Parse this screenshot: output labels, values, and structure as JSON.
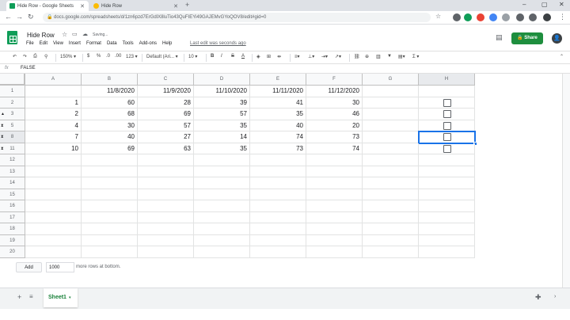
{
  "browser": {
    "tabs": [
      {
        "title": "Hide Row - Google Sheets",
        "active": true
      },
      {
        "title": "Hide Row",
        "active": false
      }
    ],
    "url": "docs.google.com/spreadsheets/d/1zn6pzd7ErGdlX8luTio43QuFIEYi49GAJEMvGYoQOV8/edit#gid=0"
  },
  "header": {
    "title": "Hide Row",
    "saving": "Saving...",
    "menu": [
      "File",
      "Edit",
      "View",
      "Insert",
      "Format",
      "Data",
      "Tools",
      "Add-ons",
      "Help"
    ],
    "last_edit": "Last edit was seconds ago",
    "share_label": "Share",
    "avatar": "👤"
  },
  "toolbar": {
    "zoom": "150%",
    "currency": "$",
    "percent": "%",
    "decimal_dec": ".0",
    "decimal_inc": ".00",
    "number_format": "123",
    "font": "Default (Ari...",
    "font_size": "10",
    "bold": "B",
    "italic": "I",
    "strike": "S",
    "text_color": "A"
  },
  "formula": {
    "label": "fx",
    "value": "FALSE"
  },
  "grid": {
    "columns": [
      "A",
      "B",
      "C",
      "D",
      "E",
      "F",
      "G",
      "H"
    ],
    "selected_column": "H",
    "rows": [
      {
        "num": "1",
        "cells": [
          "",
          "11/8/2020",
          "11/9/2020",
          "11/10/2020",
          "11/11/2020",
          "11/12/2020",
          "",
          ""
        ],
        "hidden_marker": false
      },
      {
        "num": "2",
        "cells": [
          "1",
          "60",
          "28",
          "39",
          "41",
          "30",
          "",
          "checkbox"
        ],
        "hidden_marker": false
      },
      {
        "num": "3",
        "cells": [
          "2",
          "68",
          "69",
          "57",
          "35",
          "46",
          "",
          "checkbox"
        ],
        "hidden_marker": true
      },
      {
        "num": "5",
        "cells": [
          "4",
          "30",
          "57",
          "35",
          "40",
          "20",
          "",
          "checkbox"
        ],
        "hidden_marker": true
      },
      {
        "num": "8",
        "cells": [
          "7",
          "40",
          "27",
          "14",
          "74",
          "73",
          "",
          "checkbox"
        ],
        "hidden_marker": true,
        "selected": true
      },
      {
        "num": "11",
        "cells": [
          "10",
          "69",
          "63",
          "35",
          "73",
          "74",
          "",
          "checkbox"
        ],
        "hidden_marker": true
      },
      {
        "num": "12",
        "cells": [
          "",
          "",
          "",
          "",
          "",
          "",
          "",
          ""
        ],
        "hidden_marker": false
      },
      {
        "num": "13",
        "cells": [
          "",
          "",
          "",
          "",
          "",
          "",
          "",
          ""
        ],
        "hidden_marker": false
      },
      {
        "num": "14",
        "cells": [
          "",
          "",
          "",
          "",
          "",
          "",
          "",
          ""
        ],
        "hidden_marker": false
      },
      {
        "num": "15",
        "cells": [
          "",
          "",
          "",
          "",
          "",
          "",
          "",
          ""
        ],
        "hidden_marker": false
      },
      {
        "num": "16",
        "cells": [
          "",
          "",
          "",
          "",
          "",
          "",
          "",
          ""
        ],
        "hidden_marker": false
      },
      {
        "num": "17",
        "cells": [
          "",
          "",
          "",
          "",
          "",
          "",
          "",
          ""
        ],
        "hidden_marker": false
      },
      {
        "num": "18",
        "cells": [
          "",
          "",
          "",
          "",
          "",
          "",
          "",
          ""
        ],
        "hidden_marker": false
      },
      {
        "num": "19",
        "cells": [
          "",
          "",
          "",
          "",
          "",
          "",
          "",
          ""
        ],
        "hidden_marker": false
      },
      {
        "num": "20",
        "cells": [
          "",
          "",
          "",
          "",
          "",
          "",
          "",
          ""
        ],
        "hidden_marker": false
      }
    ]
  },
  "add_rows": {
    "button": "Add",
    "count": "1000",
    "suffix": "more rows at bottom."
  },
  "sheets": {
    "active": "Sheet1"
  },
  "colors": {
    "accent": "#1a73e8",
    "share": "#1e8e3e",
    "sheets_green": "#0f9d58"
  }
}
